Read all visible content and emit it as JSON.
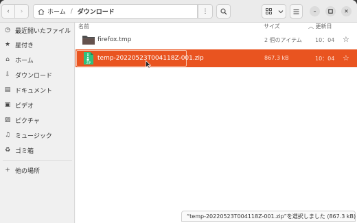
{
  "header": {
    "path": [
      "ホーム",
      "ダウンロード"
    ],
    "path_separator": "/"
  },
  "sidebar": {
    "items": [
      {
        "label": "最近開いたファイル",
        "icon": "clock-icon"
      },
      {
        "label": "星付き",
        "icon": "star-icon"
      },
      {
        "label": "ホーム",
        "icon": "home-icon"
      },
      {
        "label": "ダウンロード",
        "icon": "download-icon"
      },
      {
        "label": "ドキュメント",
        "icon": "document-icon"
      },
      {
        "label": "ビデオ",
        "icon": "video-icon"
      },
      {
        "label": "ピクチャ",
        "icon": "picture-icon"
      },
      {
        "label": "ミュージック",
        "icon": "music-icon"
      },
      {
        "label": "ゴミ箱",
        "icon": "trash-icon"
      }
    ],
    "other_locations": "他の場所"
  },
  "columns": {
    "name": "名前",
    "size": "サイズ",
    "modified": "更新日"
  },
  "files": [
    {
      "name": "firefox.tmp",
      "size": "2 個のアイテム",
      "modified": "10：04",
      "type": "folder",
      "selected": false
    },
    {
      "name": "temp-20220523T004118Z-001.zip",
      "size": "867.3 kB",
      "modified": "10：04",
      "type": "zip",
      "selected": true
    }
  ],
  "status": {
    "text": "“temp-20220523T004118Z-001.zip”を選択しました (867.3 kB)"
  },
  "colors": {
    "accent": "#e95420",
    "folder": "#5e5e5e",
    "zip": "#26a269"
  }
}
